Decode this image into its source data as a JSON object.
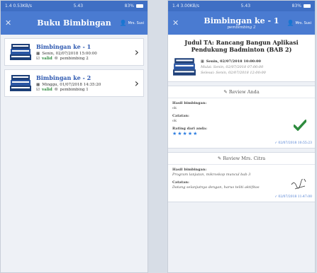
{
  "left": {
    "status": {
      "left": "1.4 0.53KB/s",
      "time": "5.43",
      "battery": "83%"
    },
    "appbar": {
      "title": "Buku Bimbingan",
      "user": "Mrs. Susi"
    },
    "items": [
      {
        "title": "Bimbingan ke - 1",
        "date": "Senin, 02/07/2018 15:00:00",
        "status": "valid",
        "pembimbing": "pembimbing 2"
      },
      {
        "title": "Bimbingan ke - 2",
        "date": "Minggu, 01/07/2018 14:35:20",
        "status": "valid",
        "pembimbing": "pembimbing 1"
      }
    ]
  },
  "right": {
    "status": {
      "left": "1.4 3.00KB/s",
      "time": "5.43",
      "battery": "83%"
    },
    "appbar": {
      "title": "Bimbingan ke - 1",
      "subtitle": "pembimbing 2",
      "user": "Mrs. Susi"
    },
    "judul": "Judul TA: Rancang Bangun Aplikasi Pendukung Badminton (BAB 2)",
    "date": "Senin, 02/07/2018 10:00:00",
    "mulai": "Mulai: Senin, 02/07/2018 07:00:00",
    "selesai": "Selesai: Senin, 02/07/2018 12:00:00",
    "review_anda": {
      "header": "Review Anda",
      "hasil_label": "Hasil bimbingan:",
      "hasil_value": "ok",
      "catatan_label": "Catatan:",
      "catatan_value": "ok",
      "rating_label": "Rating dari anda:",
      "stars": "★★★★★",
      "timestamp": "02/07/2018 10:55:23"
    },
    "review_mrs": {
      "header": "Review Mrs. Citra",
      "hasil_label": "Hasil bimbingan:",
      "hasil_value": "Program lanjutan, mikroskop muncul bab 3",
      "catatan_label": "Catatan:",
      "catatan_value": "Datang selanjutnya dengan, harus teliti aktifitas",
      "timestamp": "02/07/2018 11:47:00"
    }
  },
  "colors": {
    "appbar": "#4a7bd1",
    "status": "#3f6fc4",
    "valid": "#2e8b3e",
    "star": "#2f7ee0"
  }
}
